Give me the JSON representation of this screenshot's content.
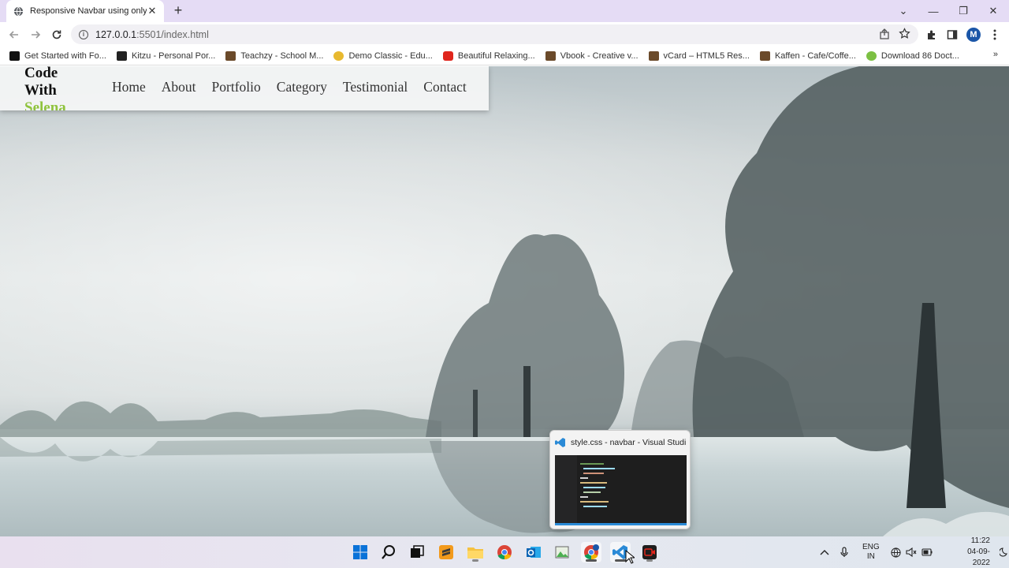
{
  "browser": {
    "tab_title": "Responsive Navbar using only ht",
    "tab_close": "✕",
    "new_tab": "+",
    "url_host": "127.0.0.1",
    "url_path": ":5501/index.html",
    "profile_initial": "M",
    "window_minimize": "—",
    "window_maximize": "❐",
    "window_close": "✕",
    "tab_search": "⌄"
  },
  "bookmarks": {
    "items": [
      {
        "label": "Get Started with Fo...",
        "color": "#111111"
      },
      {
        "label": "Kitzu - Personal Por...",
        "color": "#222222"
      },
      {
        "label": "Teachzy - School M...",
        "color": "#6b4a2a"
      },
      {
        "label": "Demo Classic - Edu...",
        "color": "#e8b92f"
      },
      {
        "label": "Beautiful Relaxing...",
        "color": "#e0261d"
      },
      {
        "label": "Vbook - Creative v...",
        "color": "#6b4a2a"
      },
      {
        "label": "vCard – HTML5 Res...",
        "color": "#6b4a2a"
      },
      {
        "label": "Kaffen - Cafe/Coffe...",
        "color": "#6b4a2a"
      },
      {
        "label": "Download 86 Doct...",
        "color": "#7cc043"
      }
    ],
    "more": "»"
  },
  "page": {
    "logo_line1": "Code",
    "logo_line2": "With",
    "logo_line3": "Selena",
    "accent_color": "#8fc33d",
    "menu": [
      "Home",
      "About",
      "Portfolio",
      "Category",
      "Testimonial",
      "Contact"
    ]
  },
  "preview": {
    "title": "style.css - navbar - Visual Studi..."
  },
  "tray": {
    "lang_line1": "ENG",
    "lang_line2": "IN",
    "time": "11:22",
    "date": "04-09-2022"
  }
}
